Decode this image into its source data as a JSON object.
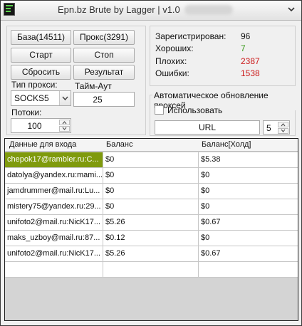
{
  "window": {
    "title": "Epn.bz Brute by Lagger | v1.0"
  },
  "buttons": {
    "base": "База(14511)",
    "proxy": "Прокс(3291)",
    "start": "Старт",
    "stop": "Стоп",
    "reset": "Сбросить",
    "result": "Результат"
  },
  "settings": {
    "proxy_type_label": "Тип прокси:",
    "proxy_type_value": "SOCKS5",
    "timeout_label": "Тайм-Аут",
    "timeout_value": "25",
    "threads_label": "Потоки:",
    "threads_value": "100"
  },
  "stats": [
    {
      "label": "Зарегистрирован:",
      "value": "96",
      "color": "#111111"
    },
    {
      "label": "Хороших:",
      "value": "7",
      "color": "#3a9a1c"
    },
    {
      "label": "Плохих:",
      "value": "2387",
      "color": "#cc1b1b"
    },
    {
      "label": "Ошибки:",
      "value": "1538",
      "color": "#cc1b1b"
    }
  ],
  "auto_update": {
    "legend": "Автоматическое обновление проксей",
    "use_label": "Использовать",
    "use_checked": false,
    "url_label": "URL",
    "interval_value": "5"
  },
  "table": {
    "columns": [
      "Данные для входа",
      "Баланс",
      "Баланс[Холд]"
    ],
    "rows": [
      [
        "chepok17@rambler.ru:C...",
        "$0",
        "$5.38"
      ],
      [
        "datolya@yandex.ru:mami...",
        "$0",
        "$0"
      ],
      [
        "jamdrummer@mail.ru:Lu...",
        "$0",
        "$0"
      ],
      [
        "mistery75@yandex.ru:29...",
        "$0",
        "$0"
      ],
      [
        "unifoto2@mail.ru:NicK17...",
        "$5.26",
        "$0.67"
      ],
      [
        "maks_uzboy@mail.ru:87...",
        "$0.12",
        "$0"
      ],
      [
        "unifoto2@mail.ru:NicK17...",
        "$5.26",
        "$0.67"
      ]
    ],
    "selected_row": 0
  }
}
